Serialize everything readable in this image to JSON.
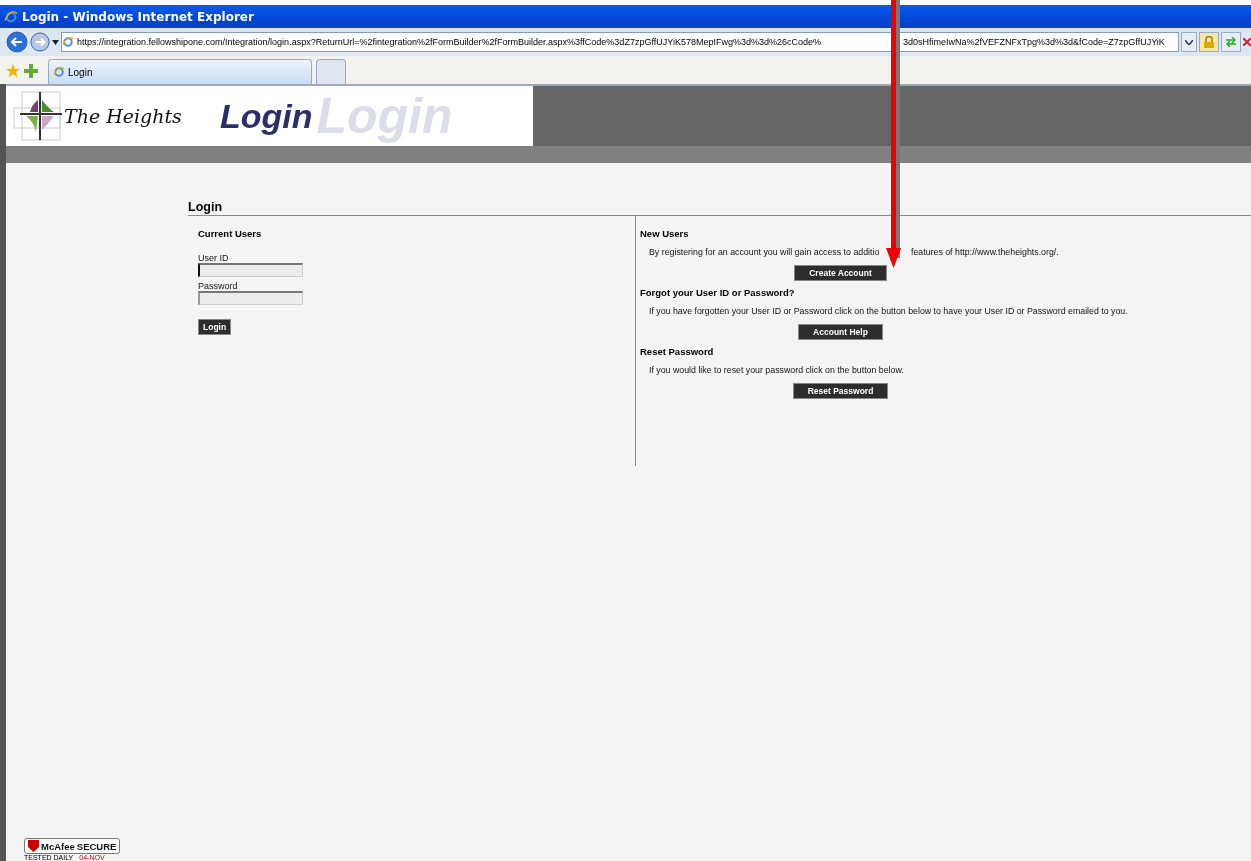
{
  "window": {
    "title": "Login - Windows Internet Explorer"
  },
  "address_bar": {
    "url_parts": [
      "https://integration.fellowshipone.com/Integration/login.aspx?ReturnUrl=%2fintegration%2fFormBuilder%2fFormBuilder.aspx%3ffCode%3dZ7zpGffUJYiK578MepIFwg%3d%3d%26cCode%",
      "3d0sHfimeIwNa%2fVEFZNFxTpg%3d%3d&fCode=Z7zpGffUJYiK"
    ]
  },
  "tabs": [
    {
      "label": "Login",
      "selected": true
    }
  ],
  "banner": {
    "brand": "The Heights",
    "title": "Login",
    "watermark": "Login"
  },
  "page_heading": "Login",
  "current_users": {
    "heading": "Current Users",
    "fields": [
      {
        "label": "User ID",
        "focused": true
      },
      {
        "label": "Password",
        "focused": false
      }
    ],
    "button": "Login"
  },
  "sections": [
    {
      "heading": "New Users",
      "text_parts": [
        "By registering for an account you will gain access to additio",
        "features of http://www.theheights.org/."
      ],
      "button": "Create Account"
    },
    {
      "heading": "Forgot your User ID or Password?",
      "text_parts": [
        "If you have forgotten your User ID or Password click on the button below to have your User ID or Password emailed to you."
      ],
      "button": "Account Help"
    },
    {
      "heading": "Reset Password",
      "text_parts": [
        "If you would like to reset your password click on the button below."
      ],
      "button": "Reset Password"
    }
  ],
  "badge": {
    "brand": "McAfee",
    "label": "SECURE",
    "tested": "TESTED DAILY",
    "date": "04-NOV"
  }
}
